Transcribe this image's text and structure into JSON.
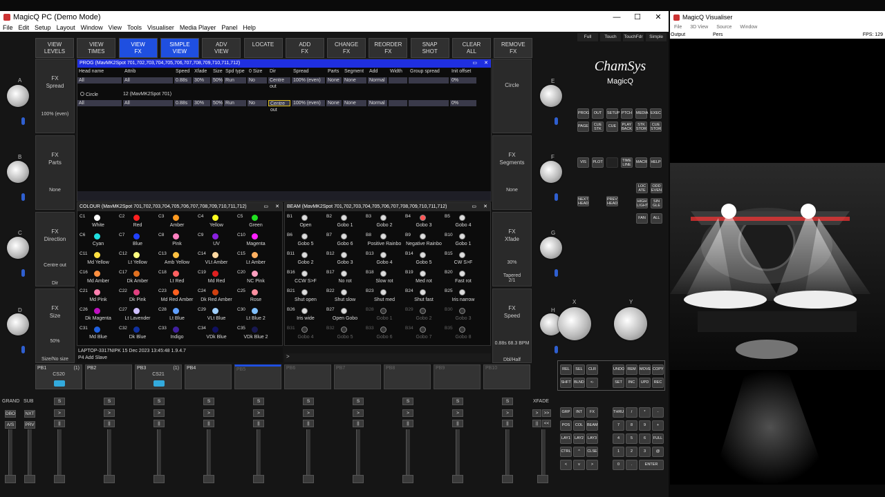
{
  "app": {
    "title": "MagicQ PC (Demo Mode)",
    "menu": [
      "File",
      "Edit",
      "Setup",
      "Layout",
      "Window",
      "View",
      "Tools",
      "Visualiser",
      "Media Player",
      "Panel",
      "Help"
    ],
    "win_controls": [
      "—",
      "☐",
      "✕"
    ]
  },
  "fbuttons": [
    {
      "label": "VIEW\nLEVELS",
      "active": false
    },
    {
      "label": "VIEW\nTIMES",
      "active": false
    },
    {
      "label": "VIEW\nFX",
      "active": true
    },
    {
      "label": "SIMPLE\nVIEW",
      "active": true
    },
    {
      "label": "ADV\nVIEW",
      "active": false
    },
    {
      "label": "LOCATE",
      "active": false
    },
    {
      "label": "ADD\nFX",
      "active": false
    },
    {
      "label": "CHANGE\nFX",
      "active": false
    },
    {
      "label": "REORDER\nFX",
      "active": false
    },
    {
      "label": "SNAP\nSHOT",
      "active": false
    },
    {
      "label": "CLEAR\nALL",
      "active": false
    },
    {
      "label": "REMOVE\nFX",
      "active": false
    }
  ],
  "left_panels": [
    {
      "title": "FX\nSpread",
      "value": "100% (even)"
    },
    {
      "title": "FX\nParts",
      "value": "None"
    },
    {
      "title": "FX\nDirection",
      "value": "Centre out",
      "sub": "Dir"
    },
    {
      "title": "FX\nSize",
      "value": "50%",
      "sub": "Size/No size"
    }
  ],
  "right_panels": [
    {
      "title": "Circle",
      "value": ""
    },
    {
      "title": "FX\nSegments",
      "value": "None"
    },
    {
      "title": "FX\nXfade",
      "value": "30%",
      "sub": "Tapered\n2/1"
    },
    {
      "title": "FX\nSpeed",
      "value": "0.88s   68.3 BPM",
      "sub": "Dbl/Half"
    }
  ],
  "encoder_labels": [
    "A",
    "B",
    "C",
    "D",
    "E",
    "F",
    "G",
    "H",
    "X",
    "Y"
  ],
  "prog": {
    "title": "PROG (MavMK2Spot 701,702,703,704,705,706,707,708,709,710,711,712)",
    "headers": [
      "Head name",
      "Attrib",
      "Speed",
      "Xfade",
      "Size",
      "Spd type",
      "0 Size",
      "Dir",
      "Spread",
      "Parts",
      "Segment",
      "Add",
      "Width",
      "Group spread",
      "Init offset"
    ],
    "row1": [
      "All",
      "All",
      "0.88s",
      "30%",
      "50%",
      "Run",
      "No",
      "Centre out",
      "100% (even)",
      "None",
      "None",
      "Normal",
      "",
      "",
      "0%"
    ],
    "fx_name": "Circle",
    "fx_heads": "12 (MavMK2Spot 701)",
    "row2": [
      "All",
      "All",
      "0.88s",
      "30%",
      "50%",
      "Run",
      "No",
      "Centre out",
      "100% (even)",
      "None",
      "None",
      "Normal",
      "",
      "",
      "0%"
    ]
  },
  "colour": {
    "title": "COLOUR (MavMK2Spot 701,702,703,704,705,706,707,708,709,710,711,712)",
    "cells": [
      {
        "n": "C1",
        "l": "White",
        "c": "#ffffff"
      },
      {
        "n": "C2",
        "l": "Red",
        "c": "#ff2020"
      },
      {
        "n": "C3",
        "l": "Amber",
        "c": "#ff9a20"
      },
      {
        "n": "C4",
        "l": "Yellow",
        "c": "#ffff20"
      },
      {
        "n": "C5",
        "l": "Green",
        "c": "#20e020"
      },
      {
        "n": "C6",
        "l": "Cyan",
        "c": "#20e0e0"
      },
      {
        "n": "C7",
        "l": "Blue",
        "c": "#2040ff"
      },
      {
        "n": "C8",
        "l": "Pink",
        "c": "#ff80c0"
      },
      {
        "n": "C9",
        "l": "UV",
        "c": "#8a20e0"
      },
      {
        "n": "C10",
        "l": "Magenta",
        "c": "#ff20ff"
      },
      {
        "n": "C11",
        "l": "Md Yellow",
        "c": "#ffe040"
      },
      {
        "n": "C12",
        "l": "Lt Yellow",
        "c": "#ffff80"
      },
      {
        "n": "C13",
        "l": "Amb Yellow",
        "c": "#ffc040"
      },
      {
        "n": "C14",
        "l": "VLt Amber",
        "c": "#ffd8a0"
      },
      {
        "n": "C15",
        "l": "Lt Amber",
        "c": "#ffb060"
      },
      {
        "n": "C16",
        "l": "Md Amber",
        "c": "#ff9040"
      },
      {
        "n": "C17",
        "l": "Dk Amber",
        "c": "#e07020"
      },
      {
        "n": "C18",
        "l": "Lt Red",
        "c": "#ff6060"
      },
      {
        "n": "C19",
        "l": "Md Red",
        "c": "#e02020"
      },
      {
        "n": "C20",
        "l": "NC Pink",
        "c": "#ffa0c0"
      },
      {
        "n": "C21",
        "l": "Md Pink",
        "c": "#ff80b0"
      },
      {
        "n": "C22",
        "l": "Dk Pink",
        "c": "#e04080"
      },
      {
        "n": "C23",
        "l": "Md Red Amber",
        "c": "#ff6020"
      },
      {
        "n": "C24",
        "l": "Dk Red Amber",
        "c": "#d04010"
      },
      {
        "n": "C25",
        "l": "Rose",
        "c": "#ff90a0"
      },
      {
        "n": "C26",
        "l": "Dk Magenta",
        "c": "#c010c0"
      },
      {
        "n": "C27",
        "l": "Lt Lavender",
        "c": "#d0c0ff"
      },
      {
        "n": "C28",
        "l": "Lt Blue",
        "c": "#60a0ff"
      },
      {
        "n": "C29",
        "l": "VLt Blue",
        "c": "#a0d0ff"
      },
      {
        "n": "C30",
        "l": "Lt Blue 2",
        "c": "#80c0ff"
      },
      {
        "n": "C31",
        "l": "Md Blue",
        "c": "#2060e0"
      },
      {
        "n": "C32",
        "l": "Dk Blue",
        "c": "#1030a0"
      },
      {
        "n": "C33",
        "l": "Indigo",
        "c": "#4020a0"
      },
      {
        "n": "C34",
        "l": "VDk Blue",
        "c": "#101060"
      },
      {
        "n": "C35",
        "l": "VDk Blue 2",
        "c": "#181850"
      }
    ]
  },
  "beam": {
    "title": "BEAM (MavMK2Spot 701,702,703,704,705,706,707,708,709,710,711,712)",
    "cells": [
      {
        "n": "B1",
        "l": "Open"
      },
      {
        "n": "B2",
        "l": "Gobo 1"
      },
      {
        "n": "B3",
        "l": "Gobo 2"
      },
      {
        "n": "B4",
        "l": "Gobo 3"
      },
      {
        "n": "B5",
        "l": "Gobo 4"
      },
      {
        "n": "B6",
        "l": "Gobo 5"
      },
      {
        "n": "B7",
        "l": "Gobo 6"
      },
      {
        "n": "B8",
        "l": "Positive Rainbo"
      },
      {
        "n": "B9",
        "l": "Negative Rainbo"
      },
      {
        "n": "B10",
        "l": "Gobo 1"
      },
      {
        "n": "B11",
        "l": "Gobo 2"
      },
      {
        "n": "B12",
        "l": "Gobo 3"
      },
      {
        "n": "B13",
        "l": "Gobo 4"
      },
      {
        "n": "B14",
        "l": "Gobo 5"
      },
      {
        "n": "B15",
        "l": "CW S>F"
      },
      {
        "n": "B16",
        "l": "CCW S>F"
      },
      {
        "n": "B17",
        "l": "No rot"
      },
      {
        "n": "B18",
        "l": "Slow rot"
      },
      {
        "n": "B19",
        "l": "Med rot"
      },
      {
        "n": "B20",
        "l": "Fast rot"
      },
      {
        "n": "B21",
        "l": "Shut open"
      },
      {
        "n": "B22",
        "l": "Shut slow"
      },
      {
        "n": "B23",
        "l": "Shut med"
      },
      {
        "n": "B24",
        "l": "Shut fast"
      },
      {
        "n": "B25",
        "l": "Iris narrow"
      },
      {
        "n": "B26",
        "l": "Iris wide"
      },
      {
        "n": "B27",
        "l": "Open Gobo"
      },
      {
        "n": "B28",
        "l": "Gobo 1"
      },
      {
        "n": "B29",
        "l": "Gobo 2"
      },
      {
        "n": "B30",
        "l": "Gobo 3"
      },
      {
        "n": "B31",
        "l": "Gobo 4"
      },
      {
        "n": "B32",
        "l": "Gobo 5"
      },
      {
        "n": "B33",
        "l": "Gobo 6"
      },
      {
        "n": "B34",
        "l": "Gobo 7"
      },
      {
        "n": "B35",
        "l": "Gobo 8"
      }
    ]
  },
  "status": {
    "line1": "LAPTOP-3317NIPK 15 Dec 2023 13:45:48 1.9.4.7",
    "line2": "P4  Add Slave",
    "prompt": ">"
  },
  "playbacks": [
    {
      "n": "PB1",
      "c": "(1)",
      "name": "CS20",
      "lit": true
    },
    {
      "n": "PB2",
      "c": "",
      "name": "",
      "lit": false
    },
    {
      "n": "PB3",
      "c": "(1)",
      "name": "CS21",
      "lit": true
    },
    {
      "n": "PB4",
      "c": "",
      "name": "",
      "lit": false
    },
    {
      "n": "PB5",
      "c": "",
      "name": "",
      "lit": false,
      "sel": true
    },
    {
      "n": "PB6",
      "c": "",
      "name": "",
      "lit": false
    },
    {
      "n": "PB7",
      "c": "",
      "name": "",
      "lit": false
    },
    {
      "n": "PB8",
      "c": "",
      "name": "",
      "lit": false
    },
    {
      "n": "PB9",
      "c": "",
      "name": "",
      "lit": false
    },
    {
      "n": "PB10",
      "c": "",
      "name": "",
      "lit": false
    }
  ],
  "fader_labels": {
    "grand": "GRAND",
    "sub": "SUB",
    "xfade": "XFADE",
    "dbo": "DBO",
    "nxt": "NXT",
    "as": "A/S",
    "prv": "PRV",
    "s": "S",
    ">": ">",
    "||": "||",
    ">>": ">>",
    "<<": "<<"
  },
  "brand": {
    "line1": "ChamSys",
    "line2": "MagicQ"
  },
  "top_tabs": [
    "Full",
    "Touch",
    "TouchFdr",
    "Simple"
  ],
  "keys_main": [
    [
      "PROG",
      "OUT",
      "SETUP",
      "PTCH",
      "MEDIA",
      "EXEC"
    ],
    [
      "PAGE",
      "CUE\nSTK",
      "CUE",
      "PLAY\nBACK",
      "STK\nSTOR",
      "CUE\nSTOR"
    ],
    [
      "VIS",
      "PLOT",
      "",
      "TIME\nLINE",
      "MACR",
      "HELP"
    ]
  ],
  "keys_side": [
    [
      "NEXT\nHEAD",
      "PREV\nHEAD"
    ],
    [
      "LOC\nATE",
      "ODD\nEVEN"
    ],
    [
      "HIGH\nLIGHT",
      "SIN\nGLE"
    ],
    [
      "FAN",
      "ALL"
    ]
  ],
  "keys_edit": [
    [
      "REL",
      "SEL",
      "CLR",
      "",
      "UNDO",
      "REM",
      "MOVE",
      "COPY"
    ],
    [
      "SHFT",
      "BLND",
      "<-",
      "",
      "SET",
      "INC",
      "UPD",
      "REC"
    ]
  ],
  "keys_num": [
    [
      "GRP",
      "INT",
      "FX",
      "",
      "THRU",
      "/",
      "*",
      "-"
    ],
    [
      "POS",
      "COL",
      "BEAM",
      "",
      "7",
      "8",
      "9",
      "+"
    ],
    [
      "LAY1",
      "LAY2",
      "LAY3",
      "",
      "4",
      "5",
      "6",
      "FULL"
    ],
    [
      "CTRL",
      "^",
      "CLSE",
      "",
      "1",
      "2",
      "3",
      "@"
    ],
    [
      "<",
      "v",
      ">",
      "",
      "0",
      ".",
      "ENTER",
      ""
    ]
  ],
  "visualiser": {
    "title": "MagicQ Visualiser",
    "menu": [
      "File",
      "3D View",
      "Source",
      "Window"
    ],
    "output": "Output",
    "pers": "Pers",
    "fps": "FPS: 129"
  }
}
